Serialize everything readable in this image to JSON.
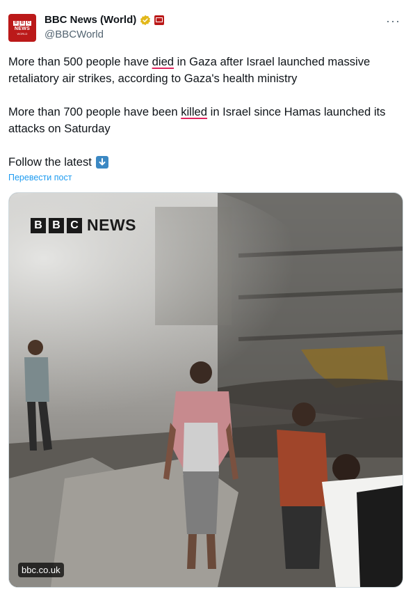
{
  "account": {
    "display_name": "BBC News (World)",
    "handle": "@BBCWorld",
    "avatar_lines": [
      "B",
      "B",
      "C"
    ],
    "avatar_word": "NEWS",
    "avatar_sub": "WORLD"
  },
  "more_menu": "···",
  "tweet": {
    "para1": {
      "before": "More than 500 people have ",
      "mark": "died",
      "after": " in Gaza after Israel launched massive retaliatory air strikes, according to Gaza's health ministry"
    },
    "para2": {
      "before": "More than 700 people have been ",
      "mark": "killed",
      "after": " in Israel since Hamas launched its attacks on Saturday"
    },
    "follow": "Follow the latest",
    "follow_icon": "down-arrow-emoji-icon"
  },
  "translate_link": "Перевести пост",
  "media": {
    "logo_blocks": [
      "B",
      "B",
      "C"
    ],
    "logo_word": "NEWS",
    "source": "bbc.co.uk"
  },
  "colors": {
    "bbc_red": "#bb1919",
    "link_blue": "#1d9bf0",
    "spell_underline": "#e0245e",
    "verified_gold": "#e2b719"
  }
}
